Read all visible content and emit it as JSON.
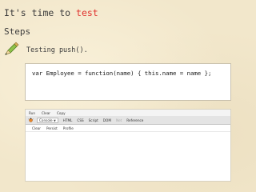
{
  "slide": {
    "title_prefix": "It's time to ",
    "title_highlight": "test",
    "subtitle": "Steps",
    "bullet": {
      "icon": "pencil-icon",
      "text": "Testing push()."
    }
  },
  "code": {
    "line": "var Employee = function(name) { this.name = name };"
  },
  "firebug": {
    "menu": [
      "Run",
      "Clear",
      "Copy"
    ],
    "tabs": [
      {
        "label": "Console",
        "selected": true
      },
      {
        "label": "HTML",
        "selected": false
      },
      {
        "label": "CSS",
        "selected": false
      },
      {
        "label": "Script",
        "selected": false
      },
      {
        "label": "DOM",
        "selected": false
      },
      {
        "label": "Net",
        "selected": false,
        "disabled": true
      },
      {
        "label": "Reference",
        "selected": false
      }
    ],
    "toolbar": [
      "Clear",
      "Persist",
      "Profile"
    ]
  },
  "colors": {
    "accent": "#e0312c",
    "background": "#f2e7cb",
    "text": "#3b3b3b"
  }
}
